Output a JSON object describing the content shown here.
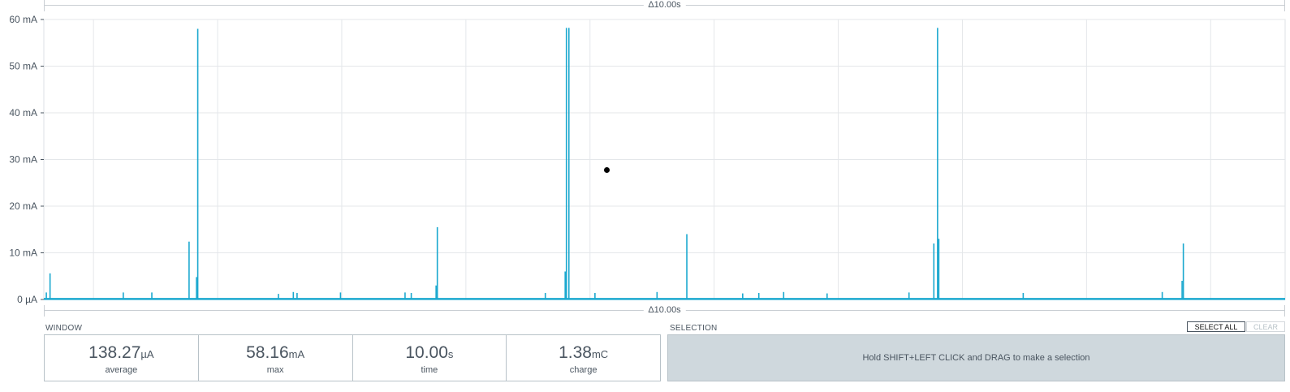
{
  "top_delta": "Δ10.00s",
  "bottom_delta": "Δ10.00s",
  "chart_data": {
    "type": "line",
    "title": "",
    "xlabel": "",
    "ylabel": "",
    "y_tick_labels": [
      "0 µA",
      "10 mA",
      "20 mA",
      "30 mA",
      "40 mA",
      "50 mA",
      "60 mA"
    ],
    "ylim_mA": [
      0,
      60
    ],
    "xlim_s": [
      0,
      10
    ],
    "grid": true,
    "color": "#1aa8cf",
    "baseline_mA": 0.1,
    "spikes": [
      {
        "t": 0.02,
        "mA": 1.5
      },
      {
        "t": 0.05,
        "mA": 5.6
      },
      {
        "t": 0.64,
        "mA": 1.5
      },
      {
        "t": 0.87,
        "mA": 1.5
      },
      {
        "t": 1.17,
        "mA": 12.4
      },
      {
        "t": 1.23,
        "mA": 4.8
      },
      {
        "t": 1.24,
        "mA": 58.0
      },
      {
        "t": 1.89,
        "mA": 1.2
      },
      {
        "t": 2.01,
        "mA": 1.6
      },
      {
        "t": 2.04,
        "mA": 1.4
      },
      {
        "t": 2.39,
        "mA": 1.5
      },
      {
        "t": 2.91,
        "mA": 1.5
      },
      {
        "t": 2.96,
        "mA": 1.4
      },
      {
        "t": 3.16,
        "mA": 3.0
      },
      {
        "t": 3.17,
        "mA": 15.5
      },
      {
        "t": 4.04,
        "mA": 1.4
      },
      {
        "t": 4.2,
        "mA": 6.0
      },
      {
        "t": 4.21,
        "mA": 58.2
      },
      {
        "t": 4.23,
        "mA": 58.2
      },
      {
        "t": 4.44,
        "mA": 1.4
      },
      {
        "t": 4.94,
        "mA": 1.6
      },
      {
        "t": 5.18,
        "mA": 14.0
      },
      {
        "t": 5.63,
        "mA": 1.3
      },
      {
        "t": 5.76,
        "mA": 1.4
      },
      {
        "t": 5.96,
        "mA": 1.6
      },
      {
        "t": 6.31,
        "mA": 1.3
      },
      {
        "t": 6.97,
        "mA": 1.5
      },
      {
        "t": 7.17,
        "mA": 12.0
      },
      {
        "t": 7.2,
        "mA": 58.2
      },
      {
        "t": 7.21,
        "mA": 13.0
      },
      {
        "t": 7.89,
        "mA": 1.4
      },
      {
        "t": 9.01,
        "mA": 1.6
      },
      {
        "t": 9.17,
        "mA": 4.0
      },
      {
        "t": 9.18,
        "mA": 12.0
      }
    ]
  },
  "window": {
    "label": "WINDOW",
    "stats": [
      {
        "value": "138.27",
        "unit": "µA",
        "name": "average"
      },
      {
        "value": "58.16",
        "unit": "mA",
        "name": "max"
      },
      {
        "value": "10.00",
        "unit": "s",
        "name": "time"
      },
      {
        "value": "1.38",
        "unit": "mC",
        "name": "charge"
      }
    ]
  },
  "selection": {
    "label": "SELECTION",
    "hint": "Hold SHIFT+LEFT CLICK and DRAG to make a selection",
    "select_all": "SELECT ALL",
    "clear": "CLEAR"
  }
}
